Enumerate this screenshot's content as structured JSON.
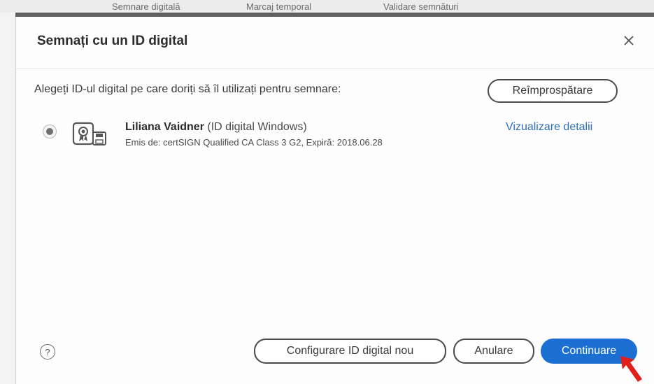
{
  "background": {
    "toolbar": {
      "items": [
        "Semnare digitală",
        "Marcaj temporal",
        "Validare semnături"
      ]
    }
  },
  "dialog": {
    "title": "Semnați cu un ID digital",
    "prompt": "Alegeți ID-ul digital pe care doriți să îl utilizați pentru semnare:",
    "refresh_label": "Reîmprospătare",
    "digital_id": {
      "name": "Liliana Vaidner",
      "type": "(ID digital Windows)",
      "issuer": "Emis de: certSIGN Qualified CA Class 3 G2, Expiră: 2018.06.28",
      "details_link": "Vizualizare detalii",
      "selected": true
    },
    "footer": {
      "help_label": "?",
      "new_id_label": "Configurare ID digital nou",
      "cancel_label": "Anulare",
      "continue_label": "Continuare"
    }
  },
  "colors": {
    "accent": "#1c6fd2",
    "link": "#2d6fb8",
    "annotation_arrow": "#e0201a"
  },
  "icons": [
    "close-icon",
    "certificate-icon",
    "help-icon",
    "pointer-arrow-icon"
  ]
}
